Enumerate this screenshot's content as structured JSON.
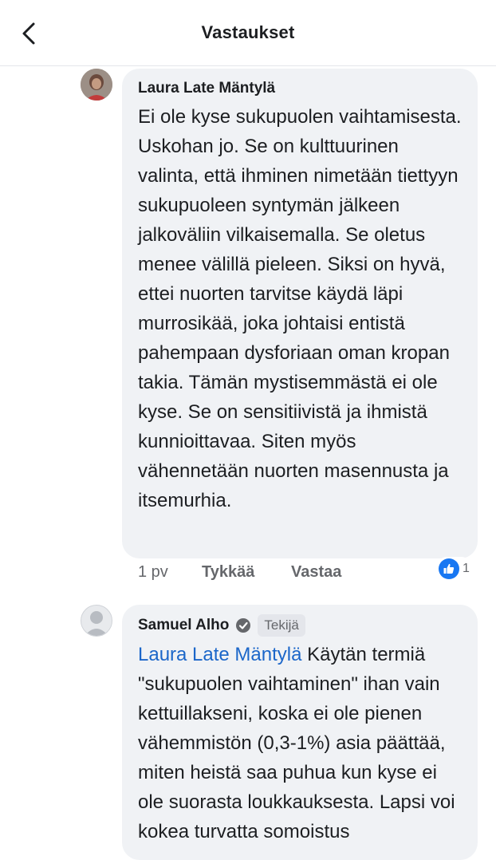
{
  "header": {
    "title": "Vastaukset"
  },
  "comments": [
    {
      "author": "Laura Late Mäntylä",
      "text": "Ei ole kyse sukupuolen vaihtamisesta. Uskohan jo. Se on kulttuurinen valinta, että ihminen nimetään tiettyyn sukupuoleen syntymän jälkeen jalkoväliin vilkaisemalla. Se oletus menee välillä pieleen. Siksi on hyvä, ettei nuorten tarvitse käydä läpi murrosikää, joka johtaisi entistä pahempaan dysforiaan oman kropan takia. Tämän mystisemmästä ei ole kyse. Se on sensitiivistä ja ihmistä kunnioittavaa. Siten myös vähennetään nuorten masennusta ja itsemurhia.",
      "time": "1 pv",
      "like_label": "Tykkää",
      "reply_label": "Vastaa",
      "reaction_count": "1"
    },
    {
      "author": "Samuel Alho",
      "badge": "Tekijä",
      "mention": "Laura Late Mäntylä",
      "text": "Käytän termiä \"sukupuolen vaihtaminen\" ihan vain kettuillakseni, koska ei ole pienen vähemmistön (0,3-1%) asia päättää, miten heistä saa puhua kun kyse ei ole suorasta loukkauksesta. Lapsi voi kokea turvatta somoistus"
    }
  ],
  "colors": {
    "bubble": "#f0f2f5",
    "mention": "#1b66c9",
    "like_blue": "#1877f2",
    "secondary_text": "#65676b"
  },
  "icons": {
    "back": "chevron-left-icon",
    "verified": "verified-badge-icon",
    "like": "thumbs-up-icon"
  }
}
